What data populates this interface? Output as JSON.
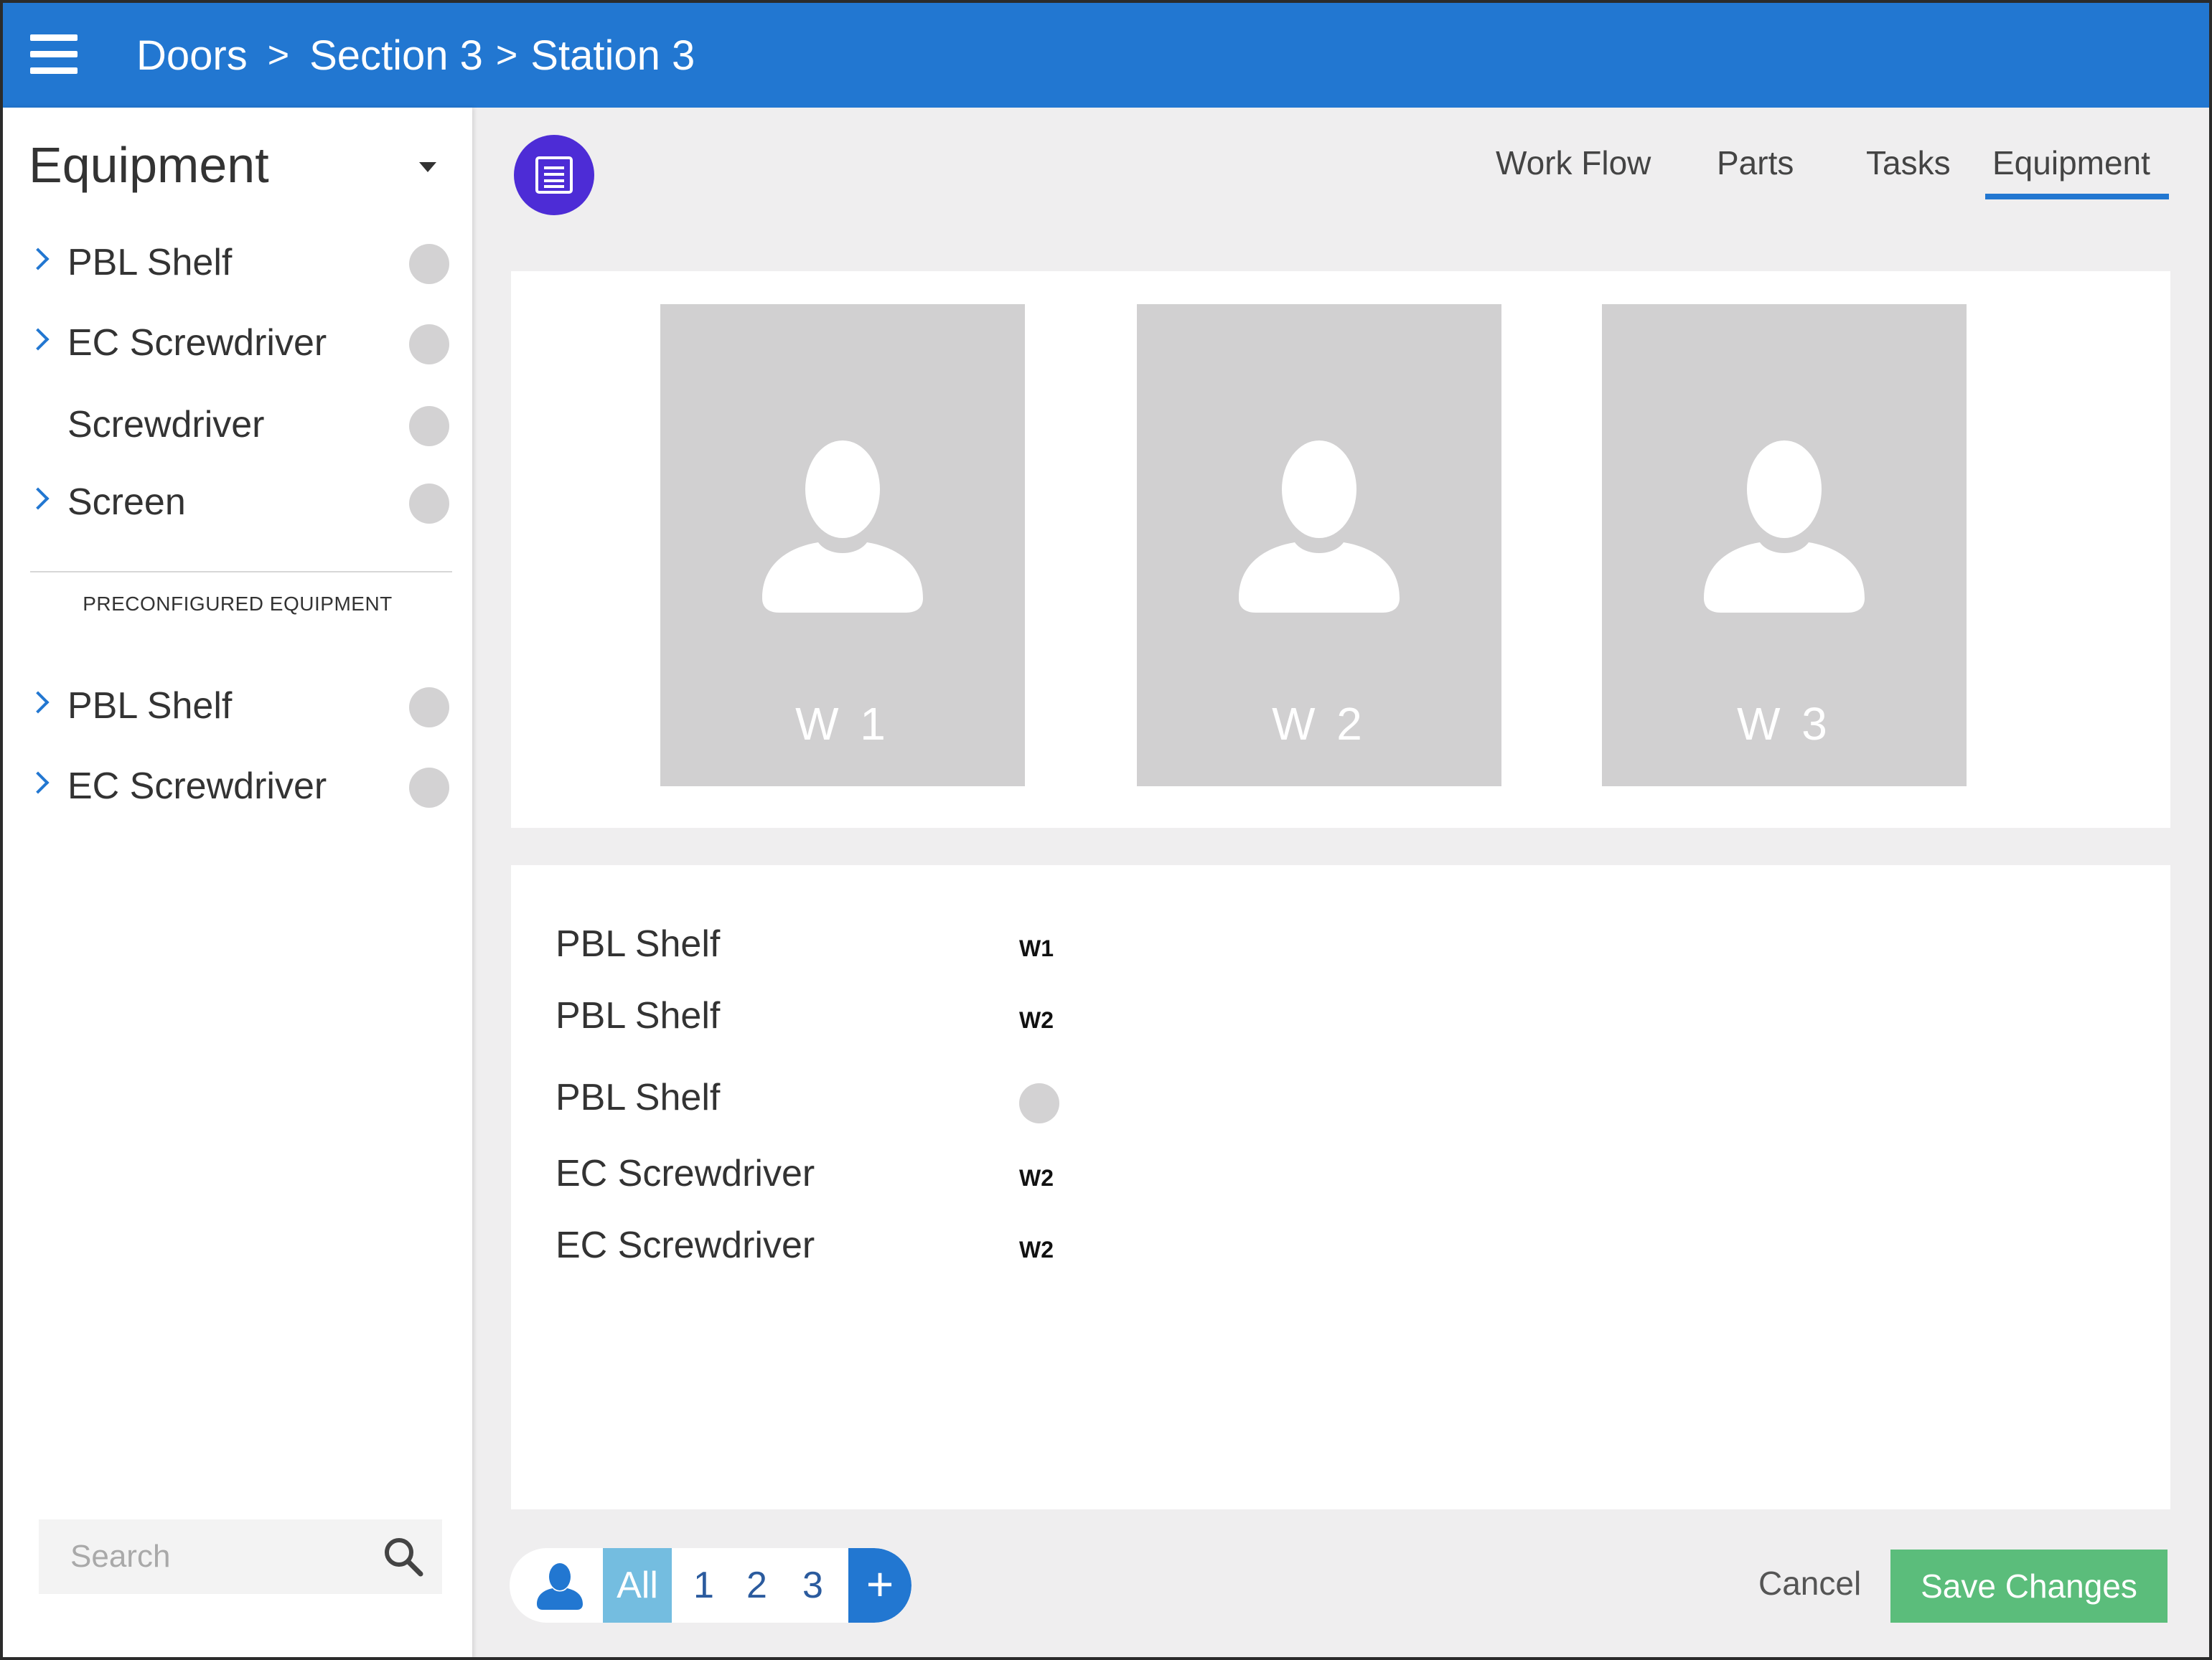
{
  "header": {
    "crumbs": [
      "Doors",
      "Section 3",
      "Station 3"
    ],
    "sep1": ">",
    "sep2": ">"
  },
  "sidebar": {
    "title": "Equipment",
    "items": [
      {
        "label": "PBL Shelf",
        "expandable": true
      },
      {
        "label": "EC Screwdriver",
        "expandable": true
      },
      {
        "label": "Screwdriver",
        "expandable": false
      },
      {
        "label": "Screen",
        "expandable": true
      }
    ],
    "preconfigured_heading": "PRECONFIGURED EQUIPMENT",
    "preconfigured_items": [
      {
        "label": "PBL Shelf",
        "expandable": true
      },
      {
        "label": "EC Screwdriver",
        "expandable": true
      }
    ],
    "search": {
      "placeholder": "Search",
      "value": ""
    }
  },
  "tabs": [
    "Work Flow",
    "Parts",
    "Tasks",
    "Equipment"
  ],
  "active_tab": "Equipment",
  "workers": [
    {
      "label": "W 1"
    },
    {
      "label": "W 2"
    },
    {
      "label": "W 3"
    }
  ],
  "equipment_list": [
    {
      "name": "PBL Shelf",
      "assignment": "W1"
    },
    {
      "name": "PBL Shelf",
      "assignment": "W2"
    },
    {
      "name": "PBL Shelf",
      "assignment": ""
    },
    {
      "name": "EC Screwdriver",
      "assignment": "W2"
    },
    {
      "name": "EC Screwdriver",
      "assignment": "W2"
    }
  ],
  "filter": {
    "all_label": "All",
    "numbers": [
      "1",
      "2",
      "3"
    ],
    "add_label": "+"
  },
  "actions": {
    "cancel_label": "Cancel",
    "save_label": "Save Changes"
  },
  "colors": {
    "header_blue": "#2277d1",
    "fab_purple": "#4d2cd6",
    "save_green": "#5bbd7b",
    "filter_all": "#74bde0"
  },
  "icons": {
    "menu": "hamburger-icon",
    "fab": "list-icon",
    "search": "search-icon",
    "worker": "person-icon",
    "expand": "chevron-right-icon"
  }
}
